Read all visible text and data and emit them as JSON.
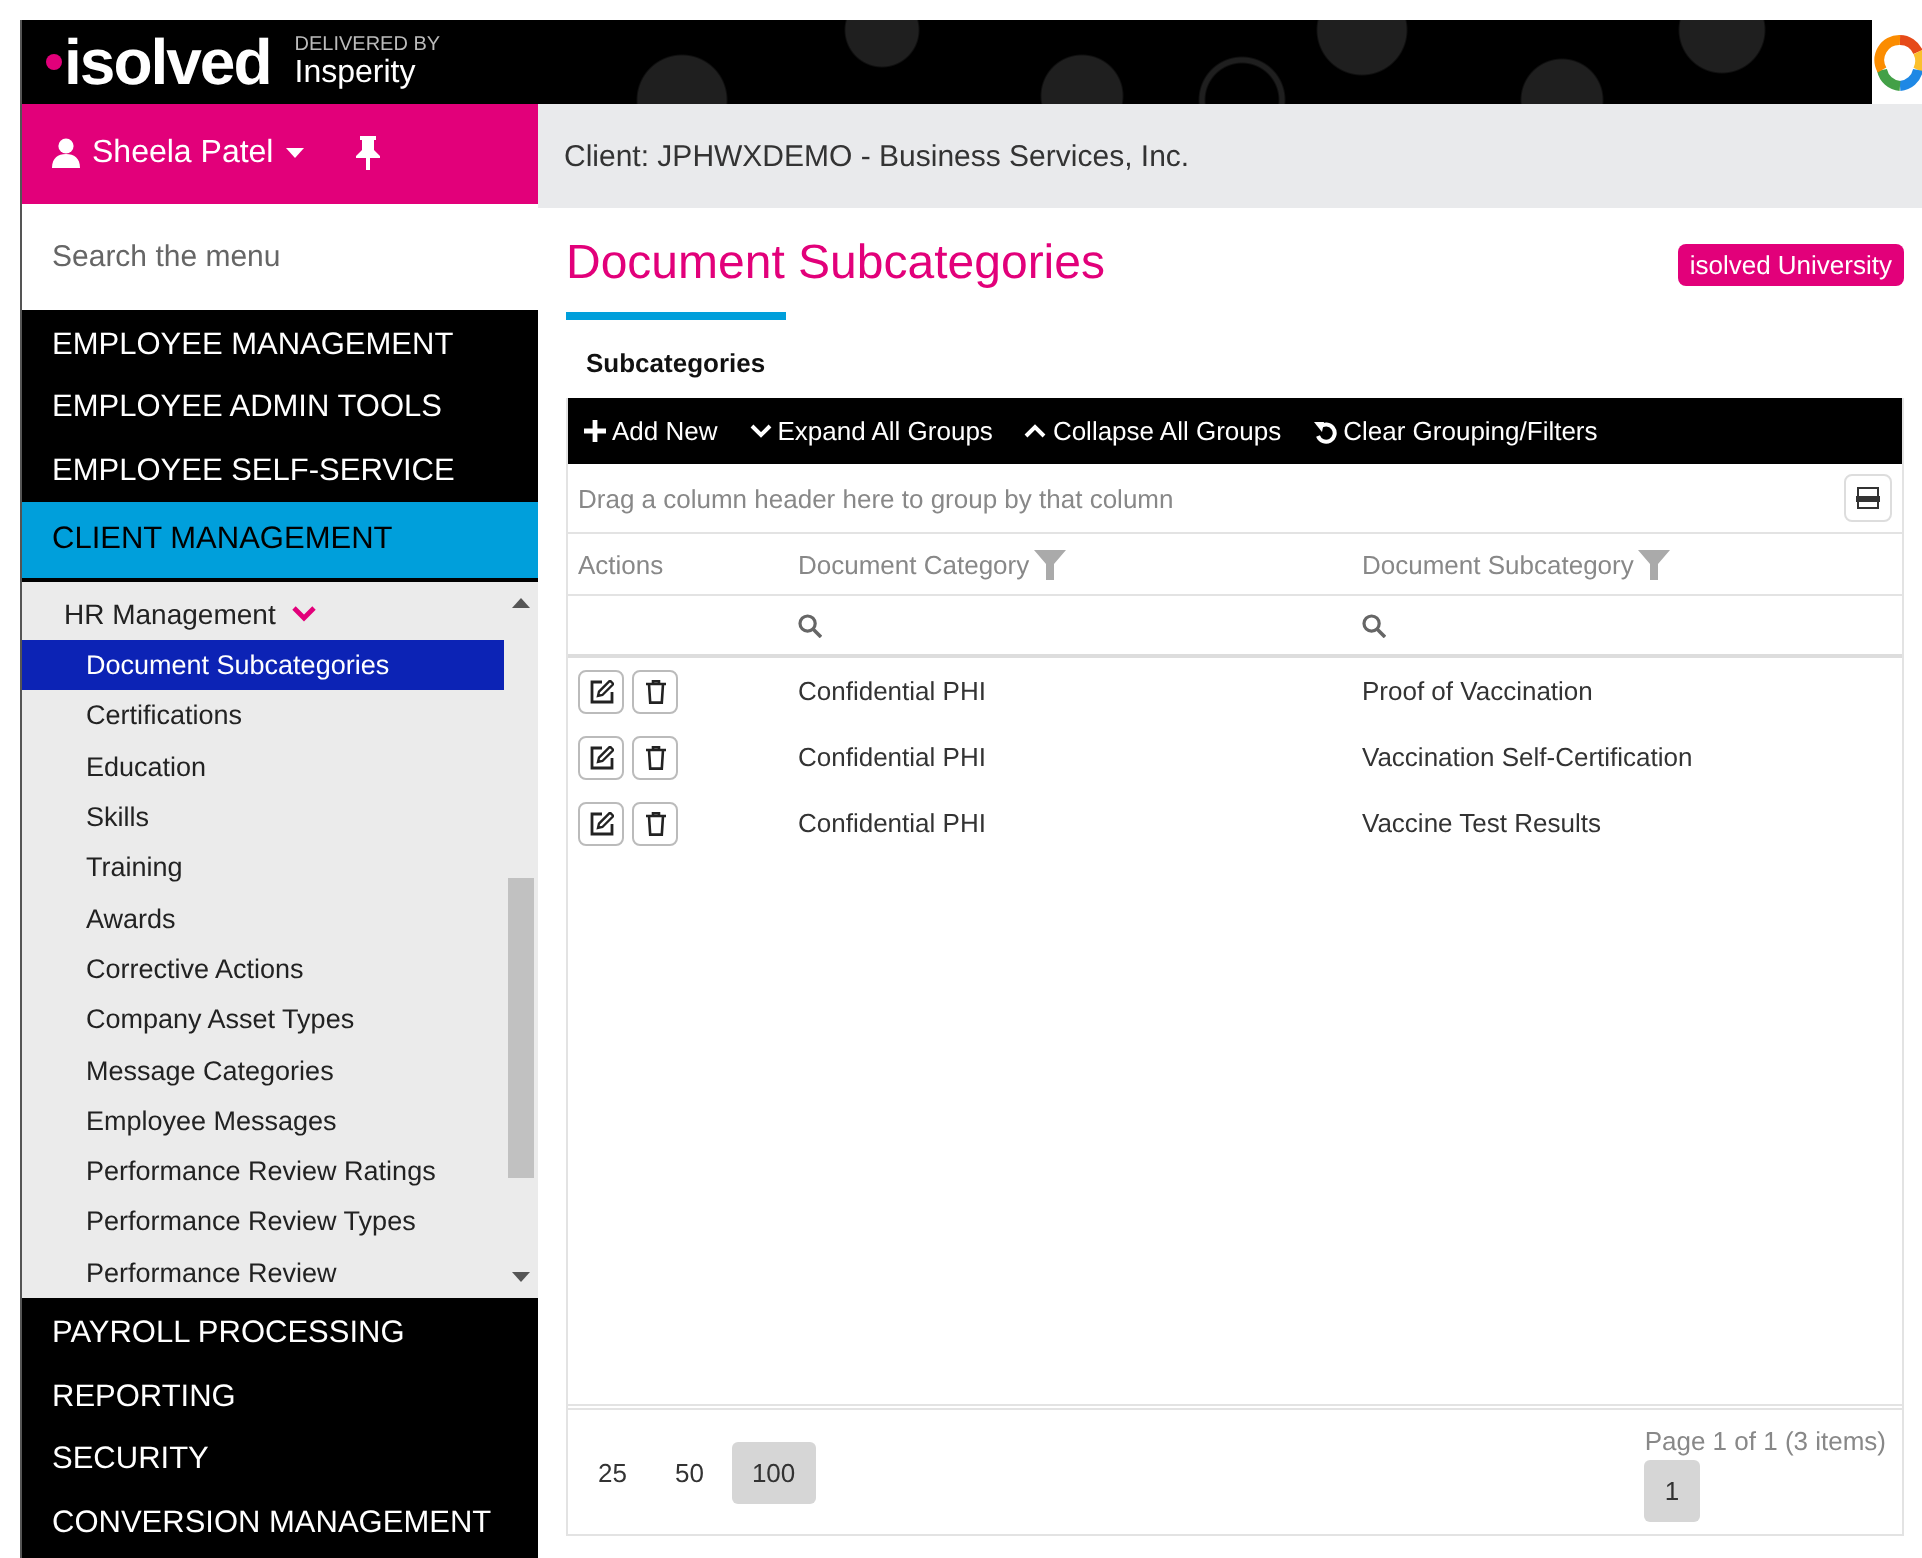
{
  "header": {
    "logo": "isolved",
    "delivered_by": "DELIVERED BY",
    "partner": "Insperity"
  },
  "sidebar": {
    "user": "Sheela Patel",
    "search": {
      "placeholder": "Search the menu"
    },
    "sections_top": [
      {
        "label": "EMPLOYEE MANAGEMENT",
        "expanded": false
      },
      {
        "label": "EMPLOYEE ADMIN TOOLS",
        "expanded": false
      },
      {
        "label": "EMPLOYEE SELF-SERVICE",
        "expanded": false
      },
      {
        "label": "CLIENT MANAGEMENT",
        "expanded": true
      }
    ],
    "submenu": {
      "label": "HR Management",
      "expanded": true,
      "children": [
        {
          "label": "Document Subcategories",
          "selected": true
        },
        {
          "label": "Certifications",
          "selected": false
        },
        {
          "label": "Education",
          "selected": false
        },
        {
          "label": "Skills",
          "selected": false
        },
        {
          "label": "Training",
          "selected": false
        },
        {
          "label": "Awards",
          "selected": false
        },
        {
          "label": "Corrective Actions",
          "selected": false
        },
        {
          "label": "Company Asset Types",
          "selected": false
        },
        {
          "label": "Message Categories",
          "selected": false
        },
        {
          "label": "Employee Messages",
          "selected": false
        },
        {
          "label": "Performance Review Ratings",
          "selected": false
        },
        {
          "label": "Performance Review Types",
          "selected": false
        },
        {
          "label": "Performance Review",
          "selected": false
        }
      ]
    },
    "sections_bottom": [
      {
        "label": "PAYROLL PROCESSING",
        "expanded": false
      },
      {
        "label": "REPORTING",
        "expanded": false
      },
      {
        "label": "SECURITY",
        "expanded": false
      },
      {
        "label": "CONVERSION MANAGEMENT",
        "expanded": false
      }
    ]
  },
  "client_bar": "Client: JPHWXDEMO - Business Services, Inc.",
  "page_title": "Document Subcategories",
  "university_link": "isolved University",
  "tabs": [
    {
      "label": "Subcategories",
      "selected": true
    }
  ],
  "toolbar": [
    {
      "kind": "plus",
      "label": "Add New"
    },
    {
      "kind": "expand",
      "label": "Expand All Groups"
    },
    {
      "kind": "collapse",
      "label": "Collapse All Groups"
    },
    {
      "kind": "undo",
      "label": "Clear Grouping/Filters"
    }
  ],
  "group_panel": "Drag a column header here to group by that column",
  "table": {
    "columns": [
      {
        "label": "Actions",
        "filterable": false
      },
      {
        "label": "Document Category",
        "filterable": true
      },
      {
        "label": "Document Subcategory",
        "filterable": true
      }
    ],
    "rows": [
      [
        "",
        "Confidential PHI",
        "Proof of Vaccination"
      ],
      [
        "",
        "Confidential PHI",
        "Vaccination Self-Certification"
      ],
      [
        "",
        "Confidential PHI",
        "Vaccine Test Results"
      ]
    ]
  },
  "pager": {
    "sizes": [
      {
        "label": "25",
        "selected": false
      },
      {
        "label": "50",
        "selected": false
      },
      {
        "label": "100",
        "selected": true
      }
    ],
    "info": "Page 1 of 1 (3 items)",
    "pages": [
      {
        "label": "1",
        "selected": true
      }
    ]
  }
}
